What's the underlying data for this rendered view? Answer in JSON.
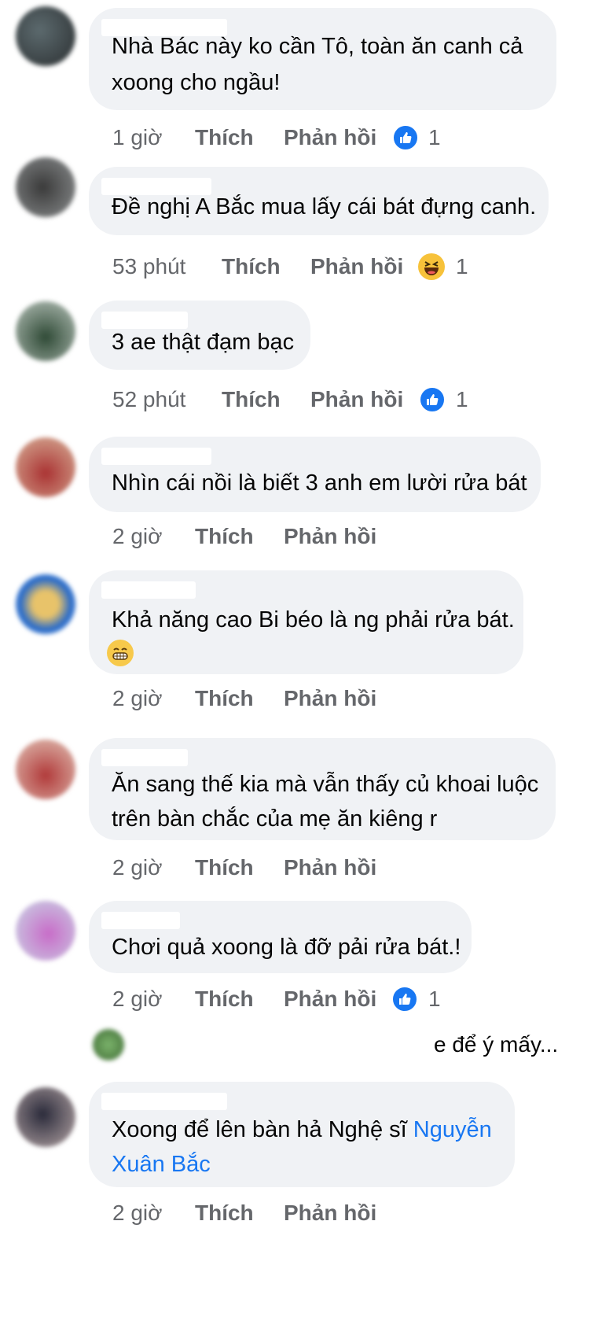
{
  "comments": [
    {
      "text_lines": [
        "Nhà Bác này ko cần Tô, toàn ăn canh cả",
        "xoong cho ngầu!"
      ],
      "time": "1 giờ",
      "like_label": "Thích",
      "reply_label": "Phản hồi",
      "reaction": "like-icon",
      "reaction_count": "1"
    },
    {
      "text_lines": [
        "Đề nghị A Bắc mua lấy cái bát đựng canh."
      ],
      "time": "53 phút",
      "like_label": "Thích",
      "reply_label": "Phản hồi",
      "reaction": "haha-icon",
      "reaction_count": "1"
    },
    {
      "text_lines": [
        "3 ae thật đạm bạc"
      ],
      "time": "52 phút",
      "like_label": "Thích",
      "reply_label": "Phản hồi",
      "reaction": "like-icon",
      "reaction_count": "1"
    },
    {
      "text_lines": [
        "Nhìn cái nồi là biết 3 anh em lười rửa bát"
      ],
      "time": "2 giờ",
      "like_label": "Thích",
      "reply_label": "Phản hồi"
    },
    {
      "text_lines": [
        "Khả năng cao Bi béo là ng phải rửa bát."
      ],
      "emoji": "grin-emoji",
      "time": "2 giờ",
      "like_label": "Thích",
      "reply_label": "Phản hồi"
    },
    {
      "text_lines": [
        "Ăn sang thế kia mà vẫn thấy củ khoai luộc",
        "trên bàn chắc của mẹ ăn kiêng r"
      ],
      "time": "2 giờ",
      "like_label": "Thích",
      "reply_label": "Phản hồi"
    },
    {
      "text_lines": [
        "Chơi quả xoong là đỡ pải rửa bát.!"
      ],
      "time": "2 giờ",
      "like_label": "Thích",
      "reply_label": "Phản hồi",
      "reaction": "like-icon",
      "reaction_count": "1"
    },
    {
      "text_lines": [
        "Xoong để lên bàn hả Nghệ sĩ ",
        "Xuân Bắc"
      ],
      "mention_part1": "Nguyễn",
      "time": "2 giờ",
      "like_label": "Thích",
      "reply_label": "Phản hồi"
    }
  ],
  "reply_preview": {
    "text": "e để ý mấy..."
  }
}
